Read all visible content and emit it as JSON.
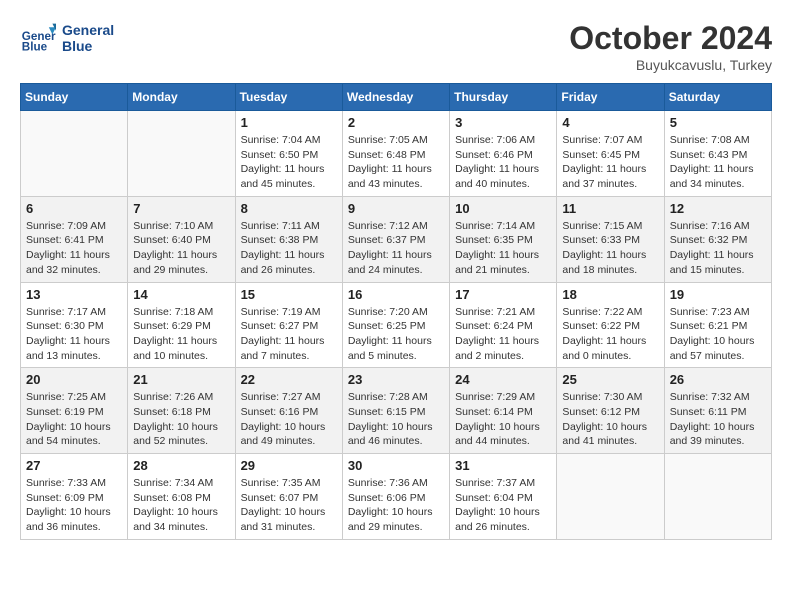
{
  "header": {
    "logo_line1": "General",
    "logo_line2": "Blue",
    "month": "October 2024",
    "location": "Buyukcavuslu, Turkey"
  },
  "weekdays": [
    "Sunday",
    "Monday",
    "Tuesday",
    "Wednesday",
    "Thursday",
    "Friday",
    "Saturday"
  ],
  "weeks": [
    [
      {
        "day": "",
        "sunrise": "",
        "sunset": "",
        "daylight": ""
      },
      {
        "day": "",
        "sunrise": "",
        "sunset": "",
        "daylight": ""
      },
      {
        "day": "1",
        "sunrise": "Sunrise: 7:04 AM",
        "sunset": "Sunset: 6:50 PM",
        "daylight": "Daylight: 11 hours and 45 minutes."
      },
      {
        "day": "2",
        "sunrise": "Sunrise: 7:05 AM",
        "sunset": "Sunset: 6:48 PM",
        "daylight": "Daylight: 11 hours and 43 minutes."
      },
      {
        "day": "3",
        "sunrise": "Sunrise: 7:06 AM",
        "sunset": "Sunset: 6:46 PM",
        "daylight": "Daylight: 11 hours and 40 minutes."
      },
      {
        "day": "4",
        "sunrise": "Sunrise: 7:07 AM",
        "sunset": "Sunset: 6:45 PM",
        "daylight": "Daylight: 11 hours and 37 minutes."
      },
      {
        "day": "5",
        "sunrise": "Sunrise: 7:08 AM",
        "sunset": "Sunset: 6:43 PM",
        "daylight": "Daylight: 11 hours and 34 minutes."
      }
    ],
    [
      {
        "day": "6",
        "sunrise": "Sunrise: 7:09 AM",
        "sunset": "Sunset: 6:41 PM",
        "daylight": "Daylight: 11 hours and 32 minutes."
      },
      {
        "day": "7",
        "sunrise": "Sunrise: 7:10 AM",
        "sunset": "Sunset: 6:40 PM",
        "daylight": "Daylight: 11 hours and 29 minutes."
      },
      {
        "day": "8",
        "sunrise": "Sunrise: 7:11 AM",
        "sunset": "Sunset: 6:38 PM",
        "daylight": "Daylight: 11 hours and 26 minutes."
      },
      {
        "day": "9",
        "sunrise": "Sunrise: 7:12 AM",
        "sunset": "Sunset: 6:37 PM",
        "daylight": "Daylight: 11 hours and 24 minutes."
      },
      {
        "day": "10",
        "sunrise": "Sunrise: 7:14 AM",
        "sunset": "Sunset: 6:35 PM",
        "daylight": "Daylight: 11 hours and 21 minutes."
      },
      {
        "day": "11",
        "sunrise": "Sunrise: 7:15 AM",
        "sunset": "Sunset: 6:33 PM",
        "daylight": "Daylight: 11 hours and 18 minutes."
      },
      {
        "day": "12",
        "sunrise": "Sunrise: 7:16 AM",
        "sunset": "Sunset: 6:32 PM",
        "daylight": "Daylight: 11 hours and 15 minutes."
      }
    ],
    [
      {
        "day": "13",
        "sunrise": "Sunrise: 7:17 AM",
        "sunset": "Sunset: 6:30 PM",
        "daylight": "Daylight: 11 hours and 13 minutes."
      },
      {
        "day": "14",
        "sunrise": "Sunrise: 7:18 AM",
        "sunset": "Sunset: 6:29 PM",
        "daylight": "Daylight: 11 hours and 10 minutes."
      },
      {
        "day": "15",
        "sunrise": "Sunrise: 7:19 AM",
        "sunset": "Sunset: 6:27 PM",
        "daylight": "Daylight: 11 hours and 7 minutes."
      },
      {
        "day": "16",
        "sunrise": "Sunrise: 7:20 AM",
        "sunset": "Sunset: 6:25 PM",
        "daylight": "Daylight: 11 hours and 5 minutes."
      },
      {
        "day": "17",
        "sunrise": "Sunrise: 7:21 AM",
        "sunset": "Sunset: 6:24 PM",
        "daylight": "Daylight: 11 hours and 2 minutes."
      },
      {
        "day": "18",
        "sunrise": "Sunrise: 7:22 AM",
        "sunset": "Sunset: 6:22 PM",
        "daylight": "Daylight: 11 hours and 0 minutes."
      },
      {
        "day": "19",
        "sunrise": "Sunrise: 7:23 AM",
        "sunset": "Sunset: 6:21 PM",
        "daylight": "Daylight: 10 hours and 57 minutes."
      }
    ],
    [
      {
        "day": "20",
        "sunrise": "Sunrise: 7:25 AM",
        "sunset": "Sunset: 6:19 PM",
        "daylight": "Daylight: 10 hours and 54 minutes."
      },
      {
        "day": "21",
        "sunrise": "Sunrise: 7:26 AM",
        "sunset": "Sunset: 6:18 PM",
        "daylight": "Daylight: 10 hours and 52 minutes."
      },
      {
        "day": "22",
        "sunrise": "Sunrise: 7:27 AM",
        "sunset": "Sunset: 6:16 PM",
        "daylight": "Daylight: 10 hours and 49 minutes."
      },
      {
        "day": "23",
        "sunrise": "Sunrise: 7:28 AM",
        "sunset": "Sunset: 6:15 PM",
        "daylight": "Daylight: 10 hours and 46 minutes."
      },
      {
        "day": "24",
        "sunrise": "Sunrise: 7:29 AM",
        "sunset": "Sunset: 6:14 PM",
        "daylight": "Daylight: 10 hours and 44 minutes."
      },
      {
        "day": "25",
        "sunrise": "Sunrise: 7:30 AM",
        "sunset": "Sunset: 6:12 PM",
        "daylight": "Daylight: 10 hours and 41 minutes."
      },
      {
        "day": "26",
        "sunrise": "Sunrise: 7:32 AM",
        "sunset": "Sunset: 6:11 PM",
        "daylight": "Daylight: 10 hours and 39 minutes."
      }
    ],
    [
      {
        "day": "27",
        "sunrise": "Sunrise: 7:33 AM",
        "sunset": "Sunset: 6:09 PM",
        "daylight": "Daylight: 10 hours and 36 minutes."
      },
      {
        "day": "28",
        "sunrise": "Sunrise: 7:34 AM",
        "sunset": "Sunset: 6:08 PM",
        "daylight": "Daylight: 10 hours and 34 minutes."
      },
      {
        "day": "29",
        "sunrise": "Sunrise: 7:35 AM",
        "sunset": "Sunset: 6:07 PM",
        "daylight": "Daylight: 10 hours and 31 minutes."
      },
      {
        "day": "30",
        "sunrise": "Sunrise: 7:36 AM",
        "sunset": "Sunset: 6:06 PM",
        "daylight": "Daylight: 10 hours and 29 minutes."
      },
      {
        "day": "31",
        "sunrise": "Sunrise: 7:37 AM",
        "sunset": "Sunset: 6:04 PM",
        "daylight": "Daylight: 10 hours and 26 minutes."
      },
      {
        "day": "",
        "sunrise": "",
        "sunset": "",
        "daylight": ""
      },
      {
        "day": "",
        "sunrise": "",
        "sunset": "",
        "daylight": ""
      }
    ]
  ]
}
